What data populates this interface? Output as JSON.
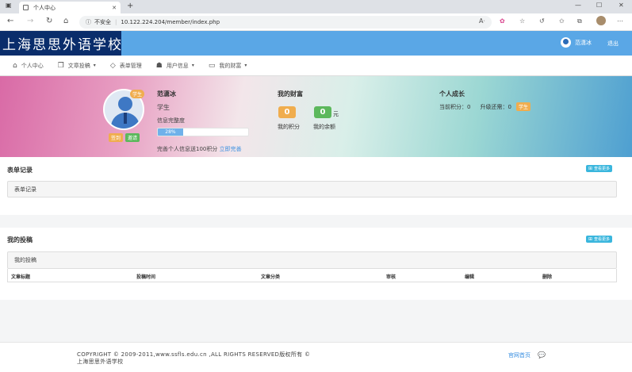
{
  "browser": {
    "tab_title": "个人中心",
    "tab_close": "✕",
    "new_tab": "+",
    "address_warning": "不安全",
    "address_url": "10.122.224.204/member/index.php",
    "win_min": "—",
    "win_max": "☐",
    "win_close": "✕"
  },
  "header": {
    "logo": "上海思思外语学校",
    "username": "范潇冰",
    "logout": "退出"
  },
  "menu": [
    {
      "label": "个人中心",
      "icon": "home-icon",
      "glyph": "⌂",
      "dropdown": false
    },
    {
      "label": "文章投稿",
      "icon": "copy-icon",
      "glyph": "❐",
      "dropdown": true
    },
    {
      "label": "表单管理",
      "icon": "diamond-icon",
      "glyph": "◇",
      "dropdown": false
    },
    {
      "label": "用户信息",
      "icon": "users-icon",
      "glyph": "☗",
      "dropdown": true
    },
    {
      "label": "我的财富",
      "icon": "card-icon",
      "glyph": "▭",
      "dropdown": true
    }
  ],
  "profile": {
    "role_badge": "学生",
    "sign_button": "签到",
    "invite_button": "邀请",
    "name": "范潇冰",
    "role": "学生",
    "completion_label": "信息完整度",
    "completion_percent": 28,
    "completion_text": "28%",
    "hint_text": "完善个人信息送100积分",
    "hint_link": "立即完善"
  },
  "wealth": {
    "title": "我的财富",
    "points": "0",
    "balance": "0",
    "unit": "元",
    "points_label": "我的积分",
    "balance_label": "我的余额"
  },
  "growth": {
    "title": "个人成长",
    "current_label": "当前积分：",
    "current_value": "0",
    "upgrade_label": "升级还需：",
    "upgrade_value": "0",
    "level_badge": "学生"
  },
  "forms_section": {
    "title": "表单记录",
    "more_button": "查看更多",
    "panel_title": "表单记录"
  },
  "posts_section": {
    "title": "我的投稿",
    "more_button": "查看更多",
    "panel_title": "我的投稿",
    "columns": [
      "文章标题",
      "投稿时间",
      "文章分类",
      "审核",
      "编辑",
      "删除"
    ]
  },
  "footer": {
    "copyright": "COPYRIGHT © 2009-2011,www.ssfls.edu.cn ,ALL RIGHTS RESERVED版权所有 © 上海思思外语学校",
    "home_link": "官网首页",
    "chat_icon": "💬"
  }
}
